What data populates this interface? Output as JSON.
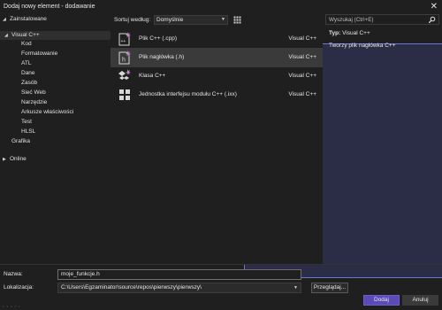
{
  "window": {
    "title": "Dodaj nowy element - dodawanie"
  },
  "tree": {
    "installed": "Zainstalowane",
    "visual_cpp": "Visual C++",
    "children": [
      "Kod",
      "Formatowanie",
      "ATL",
      "Dane",
      "Zasób",
      "Sieć Web",
      "Narzędzie",
      "Arkusze właściwości",
      "Test",
      "HLSL"
    ],
    "grafika": "Grafika",
    "online": "Online"
  },
  "toolbar": {
    "sort_label": "Sortuj według:",
    "sort_value": "Domyślnie"
  },
  "search": {
    "placeholder": "Wyszukaj (Ctrl+E)"
  },
  "templates": [
    {
      "name": "Plik C++ (.cpp)",
      "lang": "Visual C++",
      "icon": "cpp-file-icon",
      "selected": false
    },
    {
      "name": "Plik nagłówka (.h)",
      "lang": "Visual C++",
      "icon": "header-file-icon",
      "selected": true
    },
    {
      "name": "Klasa C++",
      "lang": "Visual C++",
      "icon": "cpp-class-icon",
      "selected": false
    },
    {
      "name": "Jednostka interfejsu modułu C++ (.ixx)",
      "lang": "Visual C++",
      "icon": "module-interface-icon",
      "selected": false
    }
  ],
  "details": {
    "type_label": "Typ:",
    "type_value": "Visual C++",
    "description": "Tworzy plik nagłówka C++"
  },
  "form": {
    "name_label": "Nazwa:",
    "name_value": "moje_funkcje.h",
    "location_label": "Lokalizacja:",
    "location_value": "C:\\Users\\Egzaminator\\source\\repos\\pierwszy\\pierwszy\\",
    "browse_label": "Przeglądaj...",
    "add_label": "Dodaj",
    "cancel_label": "Anuluj"
  },
  "colors": {
    "accent": "#5b4bb8",
    "background": "#1f1f1f",
    "selection": "#3a3a3a"
  }
}
